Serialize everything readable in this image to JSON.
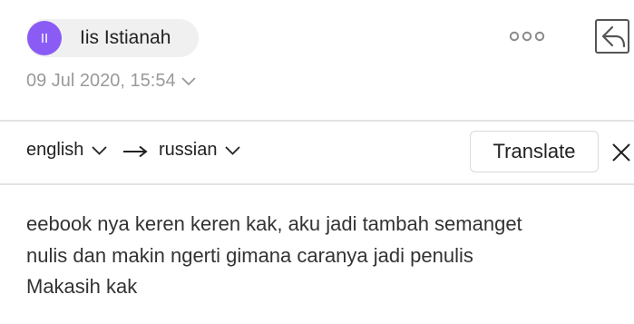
{
  "sender": {
    "initials": "II",
    "name": "Iis Istianah",
    "avatar_color": "#8a5cf5"
  },
  "header": {
    "more_icon": "more-dots-icon",
    "reply_icon": "reply-icon"
  },
  "date": {
    "text": "09 Jul 2020, 15:54"
  },
  "translator": {
    "source_lang": "english",
    "target_lang": "russian",
    "translate_label": "Translate",
    "close_icon": "close-icon"
  },
  "message": {
    "lines": [
      "eebook nya keren keren kak, aku jadi tambah semanget",
      "nulis dan makin ngerti gimana caranya jadi penulis",
      "Makasih kak"
    ]
  }
}
